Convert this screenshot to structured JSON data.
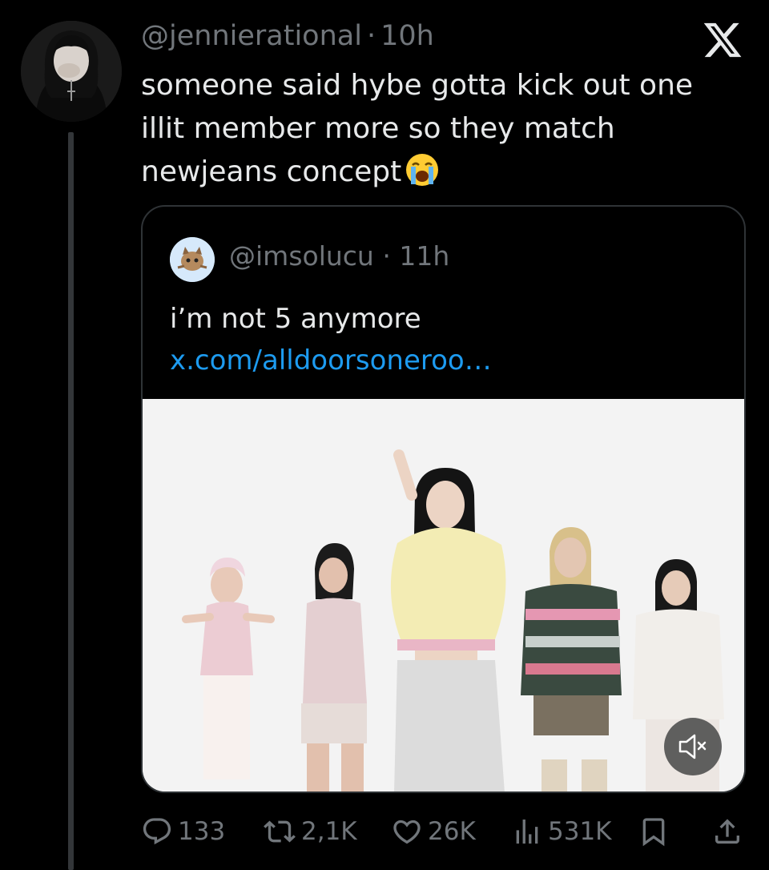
{
  "tweet": {
    "handle": "@jennierational",
    "separator": "·",
    "time": "10h",
    "text": "someone said hybe gotta kick out one illit member more so they match newjeans concept",
    "emoji": "loudly-crying-face-emoji"
  },
  "quoted_tweet": {
    "handle": "@imsolucu",
    "separator": "·",
    "time": "11h",
    "text": "i’m not 5 anymore ",
    "link": "x.com/alldoorsoneroo…",
    "media": {
      "type": "video",
      "muted": true
    }
  },
  "actions": {
    "replies": "133",
    "reposts": "2,1K",
    "likes": "26K",
    "views": "531K"
  },
  "icons": {
    "brand": "x-logo-icon",
    "reply": "reply-icon",
    "repost": "repost-icon",
    "like": "heart-icon",
    "views": "views-icon",
    "bookmark": "bookmark-icon",
    "share": "share-icon",
    "mute": "muted-speaker-icon"
  },
  "colors": {
    "background": "#000000",
    "text": "#e7e9ea",
    "secondary": "#71767b",
    "link": "#1d9bf0",
    "border": "#2f3336"
  }
}
